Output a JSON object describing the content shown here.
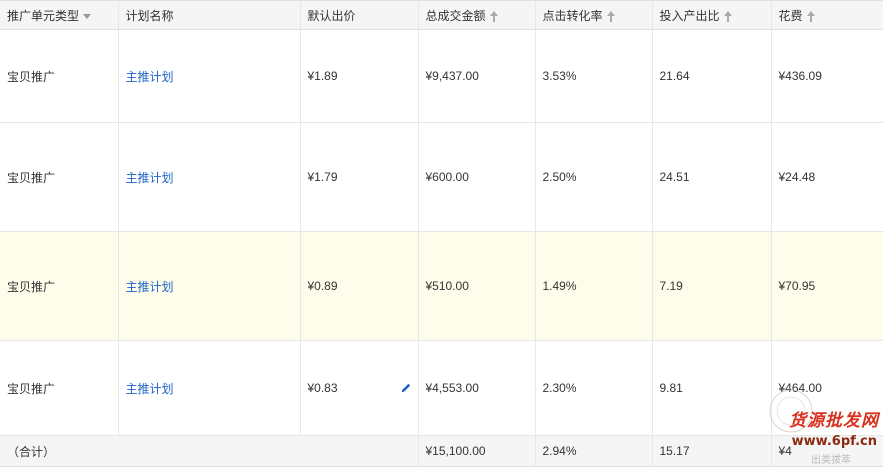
{
  "columns": [
    {
      "label": "推广单元类型",
      "sort": "desc"
    },
    {
      "label": "计划名称",
      "sort": "none"
    },
    {
      "label": "默认出价",
      "sort": "none"
    },
    {
      "label": "总成交金额",
      "sort": "asc"
    },
    {
      "label": "点击转化率",
      "sort": "asc"
    },
    {
      "label": "投入产出比",
      "sort": "asc"
    },
    {
      "label": "花费",
      "sort": "asc"
    }
  ],
  "rows": [
    {
      "unit_type": "宝贝推广",
      "plan": "主推计划",
      "bid": "¥1.89",
      "amount": "¥9,437.00",
      "cvr": "3.53%",
      "roi": "21.64",
      "cost": "¥436.09"
    },
    {
      "unit_type": "宝贝推广",
      "plan": "主推计划",
      "bid": "¥1.79",
      "amount": "¥600.00",
      "cvr": "2.50%",
      "roi": "24.51",
      "cost": "¥24.48"
    },
    {
      "unit_type": "宝贝推广",
      "plan": "主推计划",
      "bid": "¥0.89",
      "amount": "¥510.00",
      "cvr": "1.49%",
      "roi": "7.19",
      "cost": "¥70.95",
      "highlighted": true
    },
    {
      "unit_type": "宝贝推广",
      "plan": "主推计划",
      "bid": "¥0.83",
      "amount": "¥4,553.00",
      "cvr": "2.30%",
      "roi": "9.81",
      "cost": "¥464.00",
      "edit_icon": "pencil-icon"
    }
  ],
  "total": {
    "label": "（合计）",
    "amount": "¥15,100.00",
    "cvr": "2.94%",
    "roi": "15.17",
    "cost": "¥4"
  },
  "watermark": {
    "brand": "货源批发网",
    "url": "www.6pf.cn",
    "sub": "出类拔萃"
  },
  "colors": {
    "link": "#1e64c8",
    "header_bg": "#f5f5f5",
    "highlight_row": "#fefdeb",
    "watermark": "#d9311f"
  }
}
